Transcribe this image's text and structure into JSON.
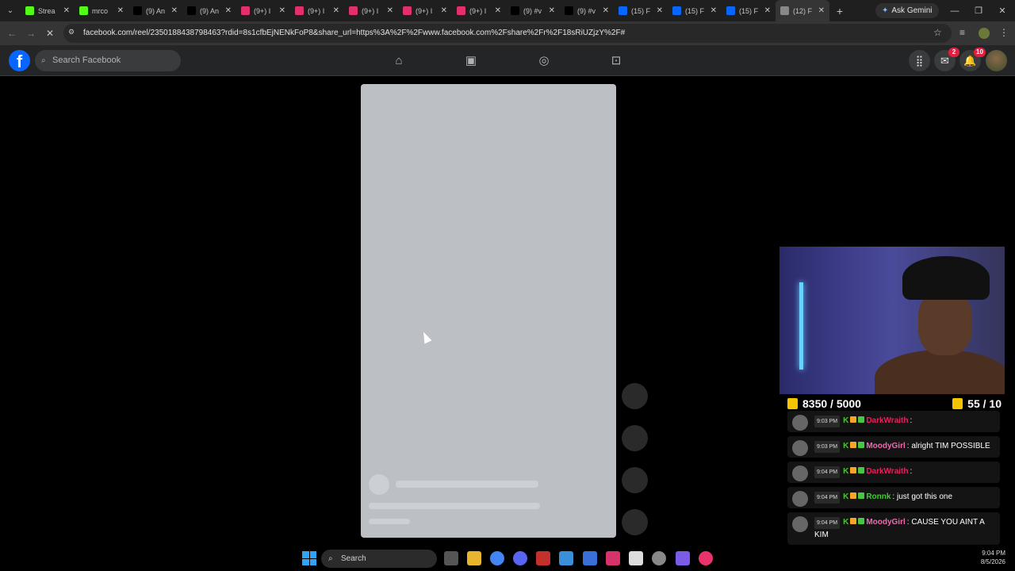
{
  "browser": {
    "tabs": [
      {
        "title": "Strea",
        "icon": "kick-icon",
        "color": "#53fc18",
        "active": false
      },
      {
        "title": "mrco",
        "icon": "kick-icon",
        "color": "#53fc18",
        "active": false
      },
      {
        "title": "(9) An",
        "icon": "tiktok-icon",
        "color": "#000000",
        "active": false
      },
      {
        "title": "(9) An",
        "icon": "tiktok-icon",
        "color": "#000000",
        "active": false
      },
      {
        "title": "(9+) I",
        "icon": "instagram-icon",
        "color": "#e1306c",
        "active": false
      },
      {
        "title": "(9+) I",
        "icon": "instagram-icon",
        "color": "#e1306c",
        "active": false
      },
      {
        "title": "(9+) I",
        "icon": "instagram-icon",
        "color": "#e1306c",
        "active": false
      },
      {
        "title": "(9+) I",
        "icon": "instagram-icon",
        "color": "#e1306c",
        "active": false
      },
      {
        "title": "(9+) I",
        "icon": "instagram-icon",
        "color": "#e1306c",
        "active": false
      },
      {
        "title": "(9) #v",
        "icon": "tiktok-icon",
        "color": "#000000",
        "active": false
      },
      {
        "title": "(9) #v",
        "icon": "tiktok-icon",
        "color": "#000000",
        "active": false
      },
      {
        "title": "(15) F",
        "icon": "facebook-icon",
        "color": "#0866ff",
        "active": false
      },
      {
        "title": "(15) F",
        "icon": "facebook-icon",
        "color": "#0866ff",
        "active": false
      },
      {
        "title": "(15) F",
        "icon": "facebook-icon",
        "color": "#0866ff",
        "active": false
      },
      {
        "title": "(12) F",
        "icon": "loading-icon",
        "color": "#888888",
        "active": true
      }
    ],
    "ask_gemini": "Ask Gemini",
    "url": "facebook.com/reel/2350188438798463?rdid=8s1cfbEjNENkFoP8&share_url=https%3A%2F%2Fwww.facebook.com%2Fshare%2Fr%2F18sRiUZjzY%2F#"
  },
  "facebook": {
    "logo": "f",
    "search_placeholder": "Search Facebook",
    "messenger_badge": "2",
    "notifications_badge": "10",
    "accent": "#0866ff"
  },
  "stream": {
    "goal_left": "8350 / 5000",
    "goal_right": "55 / 10",
    "chat": [
      {
        "time": "9:03 PM",
        "user": "DarkWraith",
        "user_color": "#e0245e",
        "text": ":"
      },
      {
        "time": "9:03 PM",
        "user": "MoodyGirl",
        "user_color": "#f06ab0",
        "text": ": alright TIM POSSIBLE"
      },
      {
        "time": "9:04 PM",
        "user": "DarkWraith",
        "user_color": "#e0245e",
        "text": ":"
      },
      {
        "time": "9:04 PM",
        "user": "Ronnk",
        "user_color": "#47c73a",
        "text": ": just got this one"
      },
      {
        "time": "9:04 PM",
        "user": "MoodyGirl",
        "user_color": "#f06ab0",
        "text": ": CAUSE YOU AINT A KIM"
      }
    ]
  },
  "taskbar": {
    "search_label": "Search",
    "time": "9:04 PM",
    "date": "8/5/2026"
  }
}
